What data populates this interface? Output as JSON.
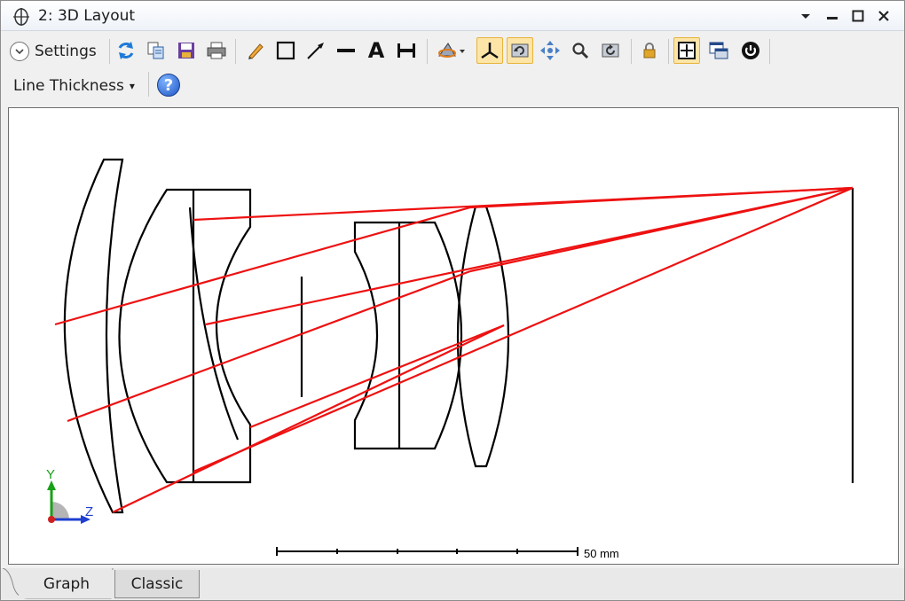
{
  "window": {
    "title": "2: 3D Layout",
    "controls": [
      "dropdown-arrow",
      "minimize",
      "maximize",
      "close"
    ]
  },
  "toolbar": {
    "settings_label": "Settings",
    "line_thickness_label": "Line Thickness",
    "line_thickness_arrow": "▾",
    "help_label": "?",
    "buttons": [
      {
        "name": "refresh-icon"
      },
      {
        "name": "copy-icon"
      },
      {
        "name": "save-icon"
      },
      {
        "name": "print-icon"
      },
      {
        "name": "pencil-icon"
      },
      {
        "name": "rectangle-icon"
      },
      {
        "name": "arrow-icon"
      },
      {
        "name": "line-icon"
      },
      {
        "name": "text-icon",
        "glyph": "A"
      },
      {
        "name": "dimension-icon"
      },
      {
        "name": "rotate-view-icon"
      },
      {
        "name": "axes-icon",
        "active": true
      },
      {
        "name": "auto-rotate-icon",
        "active": true
      },
      {
        "name": "pan-icon"
      },
      {
        "name": "zoom-icon"
      },
      {
        "name": "reset-view-icon"
      },
      {
        "name": "lock-icon"
      },
      {
        "name": "window-layout-icon",
        "active": true
      },
      {
        "name": "window-float-icon"
      },
      {
        "name": "power-icon"
      }
    ]
  },
  "layout": {
    "scale_label": "50 mm",
    "axis_labels": {
      "y": "Y",
      "z": "Z"
    },
    "ray_color": "#ee1111",
    "lens_color": "#000000"
  },
  "tabs": [
    {
      "label": "Graph",
      "active": true
    },
    {
      "label": "Classic",
      "active": false
    }
  ]
}
